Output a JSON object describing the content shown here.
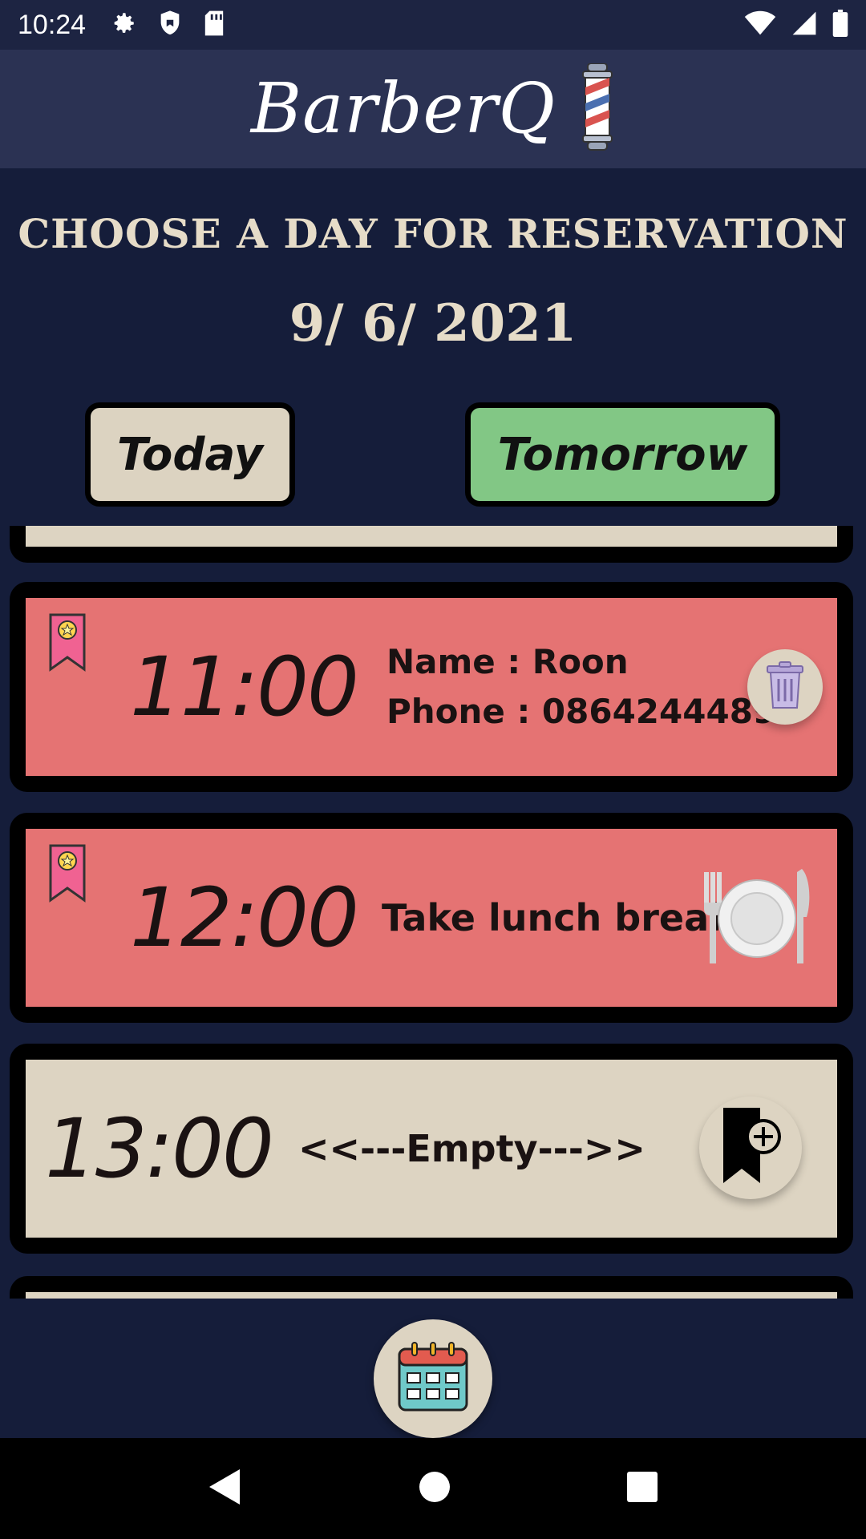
{
  "status_bar": {
    "time": "10:24",
    "left_icons": [
      "gear-icon",
      "shield-icon",
      "sd-card-icon"
    ],
    "right_icons": [
      "wifi-icon",
      "signal-icon",
      "battery-icon"
    ]
  },
  "header": {
    "app_name": "BarberQ",
    "logo_icon": "barber-pole-icon"
  },
  "reservation": {
    "title": "CHOOSE A DAY FOR RESERVATION",
    "date": "9/ 6/ 2021"
  },
  "day_buttons": {
    "today": "Today",
    "tomorrow": "Tomorrow",
    "today_color": "#dcd3c1",
    "tomorrow_color": "#82c785"
  },
  "slots": [
    {
      "time": "11:00",
      "status": "booked",
      "name_line": "Name : Roon",
      "phone_line": "Phone : 0864244489",
      "action_icon": "trash-icon",
      "color": "#e57373"
    },
    {
      "time": "12:00",
      "status": "break",
      "note": "Take  lunch break",
      "action_icon": "plate-cutlery-icon",
      "color": "#e57373"
    },
    {
      "time": "13:00",
      "status": "empty",
      "note": "<<---Empty--->>",
      "action_icon": "add-bookmark-icon",
      "color": "#ddd4c2"
    }
  ],
  "fab": {
    "icon": "calendar-icon"
  },
  "nav_bar": {
    "icons": [
      "back-icon",
      "home-icon",
      "recents-icon"
    ]
  }
}
